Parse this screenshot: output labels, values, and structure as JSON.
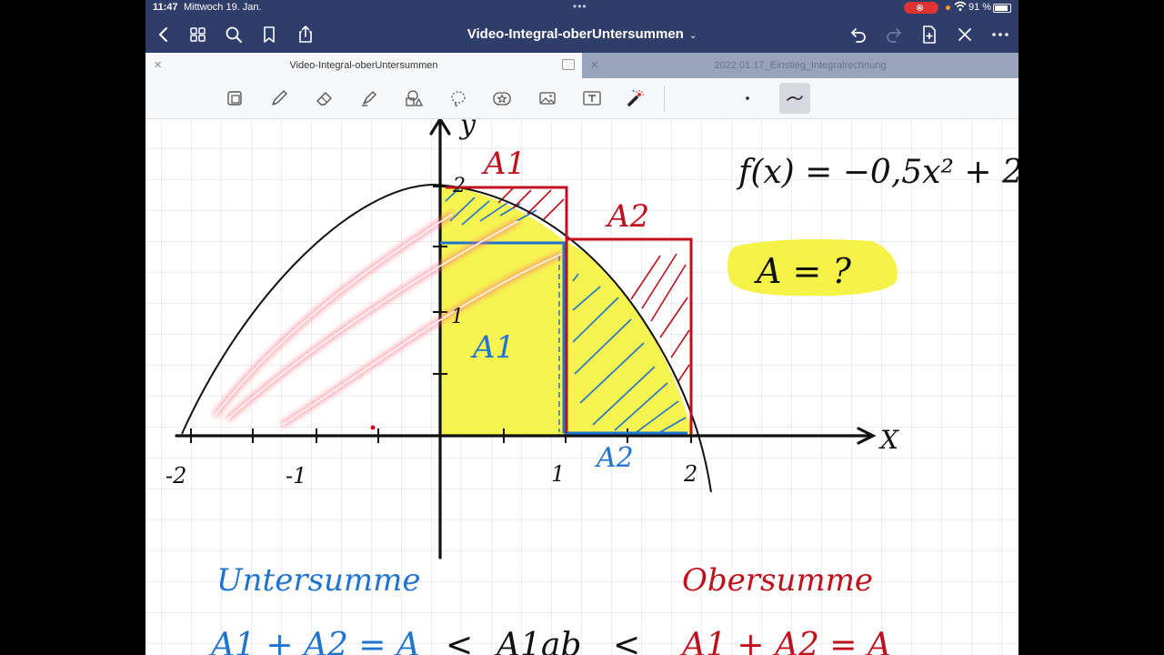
{
  "status_bar": {
    "time": "11:47",
    "date": "Mittwoch 19. Jan.",
    "battery": "91 %"
  },
  "nav": {
    "document_title": "Video-Integral-oberUntersummen",
    "icons": [
      "back-icon",
      "grid-icon",
      "search-icon",
      "bookmark-icon",
      "share-icon",
      "undo-icon",
      "redo-icon",
      "add-page-icon",
      "close-icon",
      "more-icon"
    ]
  },
  "tabs": [
    {
      "label": "Video-Integral-oberUntersummen",
      "active": true
    },
    {
      "label": "2022.01.17_Einstieg_Integralrechnung",
      "active": false
    }
  ],
  "toolbar": {
    "tools": [
      "reader-mode-icon",
      "pen-icon",
      "eraser-icon",
      "highlighter-icon",
      "shapes-icon",
      "lasso-icon",
      "sticker-icon",
      "image-icon",
      "text-icon",
      "laser-pointer-icon"
    ],
    "selected_stroke": "stroke-style-icon"
  },
  "handwriting": {
    "function": "f(x) = −0,5x² + 2",
    "question": "A = ?",
    "y_axis_label": "y",
    "x_axis_label": "X",
    "tick_labels": [
      "-2",
      "-1",
      "1",
      "2",
      "1",
      "2"
    ],
    "area_labels": {
      "red_a1": "A1",
      "red_a2": "A2",
      "blue_a1": "A1",
      "blue_a2": "A2"
    },
    "lower_sum_title": "Untersumme",
    "upper_sum_title": "Obersumme",
    "lower_sum_formula": "A1 + A2 = A",
    "less_than_1": "<",
    "middle_formula": "A1ab",
    "less_than_2": "<",
    "upper_sum_formula": "A1 + A2 = A"
  },
  "colors": {
    "navbar": "#2f3d6a",
    "red_ink": "#c0101d",
    "blue_ink": "#1f74d0",
    "highlight_yellow": "#f4f233",
    "grid": "#d9dbe0"
  }
}
